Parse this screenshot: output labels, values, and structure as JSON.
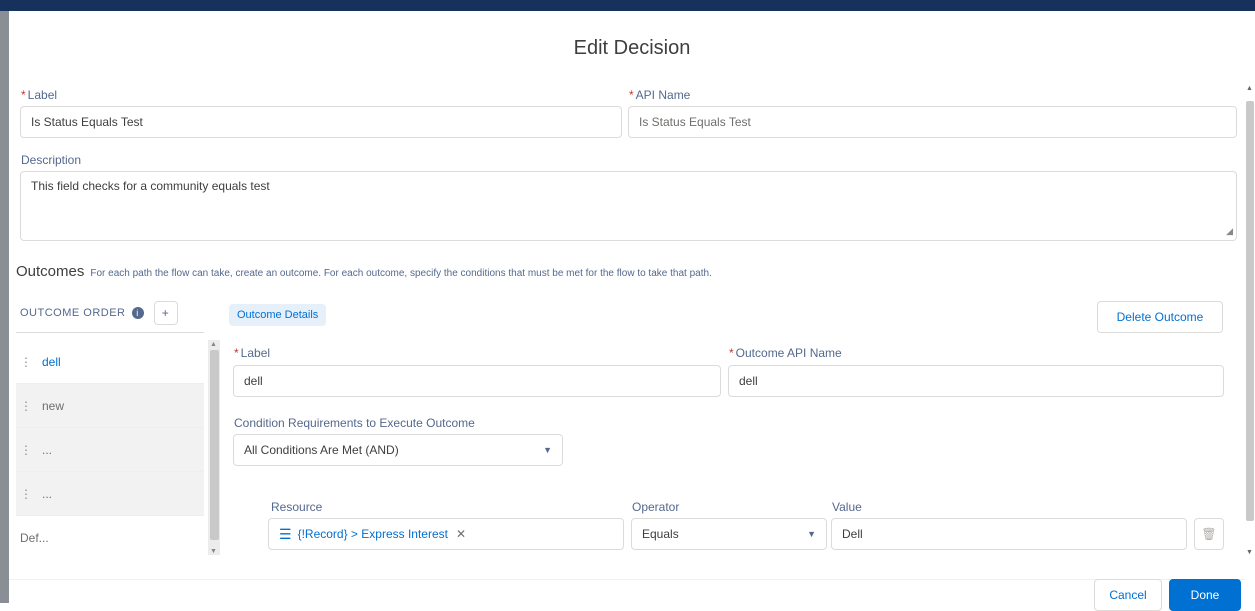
{
  "dialog": {
    "title": "Edit Decision"
  },
  "fields": {
    "label": {
      "label": "Label",
      "value": "Is Status Equals Test"
    },
    "api_name": {
      "label": "API Name",
      "value": "Is Status Equals Test"
    },
    "description": {
      "label": "Description",
      "value": "This field checks for a community equals test"
    }
  },
  "outcomes": {
    "heading": "Outcomes",
    "help": "For each path the flow can take, create an outcome. For each outcome, specify the conditions that must be met for the flow to take that path.",
    "order_label": "OUTCOME ORDER",
    "info": "i",
    "add": "+",
    "items": [
      {
        "label": "dell"
      },
      {
        "label": "new"
      },
      {
        "label": "..."
      },
      {
        "label": "..."
      },
      {
        "label": "Def..."
      }
    ]
  },
  "detail": {
    "badge": "Outcome Details",
    "delete_button": "Delete Outcome",
    "label_field": {
      "label": "Label",
      "value": "dell"
    },
    "api_field": {
      "label": "Outcome API Name",
      "value": "dell"
    },
    "condition_requirements": {
      "label": "Condition Requirements to Execute Outcome",
      "value": "All Conditions Are Met (AND)"
    },
    "condition_row": {
      "resource_label": "Resource",
      "resource_value": "{!Record} > Express Interest",
      "operator_label": "Operator",
      "operator_value": "Equals",
      "value_label": "Value",
      "value_value": "Dell"
    }
  },
  "footer": {
    "cancel": "Cancel",
    "done": "Done"
  },
  "colors": {
    "brand": "#0070d2",
    "topbar": "#16325c",
    "required": "#c23934"
  }
}
